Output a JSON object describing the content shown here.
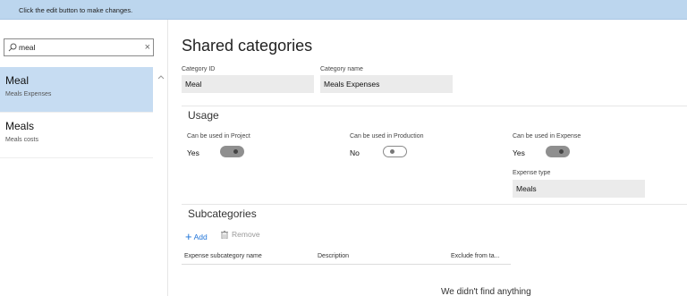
{
  "infobar": {
    "message": "Click the edit button to make changes."
  },
  "search": {
    "value": "meal",
    "clear_glyph": "×"
  },
  "list": {
    "items": [
      {
        "title": "Meal",
        "subtitle": "Meals Expenses",
        "selected": true
      },
      {
        "title": "Meals",
        "subtitle": "Meals costs",
        "selected": false
      }
    ]
  },
  "page": {
    "title": "Shared categories"
  },
  "fields": {
    "category_id": {
      "label": "Category ID",
      "value": "Meal"
    },
    "category_name": {
      "label": "Category name",
      "value": "Meals Expenses"
    }
  },
  "usage": {
    "title": "Usage",
    "project": {
      "label": "Can be used in Project",
      "value": "Yes",
      "on": true
    },
    "production": {
      "label": "Can be used in Production",
      "value": "No",
      "on": false
    },
    "expense": {
      "label": "Can be used in Expense",
      "value": "Yes",
      "on": true
    },
    "expense_type": {
      "label": "Expense type",
      "value": "Meals"
    }
  },
  "subcategories": {
    "title": "Subcategories",
    "add_label": "Add",
    "remove_label": "Remove",
    "columns": [
      "Expense subcategory name",
      "Description",
      "Exclude from ta..."
    ],
    "empty_message": "We didn't find anything"
  },
  "icons": {
    "search": "search-icon",
    "clear": "close-icon",
    "scroll_up": "chevron-up-icon",
    "add": "plus-icon",
    "remove": "trash-icon"
  },
  "colors": {
    "accent": "#1e73d8",
    "selected_row": "#c6dcf2",
    "infobar": "#bcd6ee",
    "field_bg": "#ebebeb"
  }
}
